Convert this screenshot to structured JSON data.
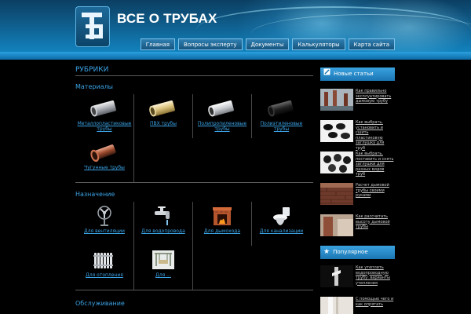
{
  "site": {
    "title": "ВСЕ О ТРУБАХ",
    "logo_icon": "pipe-logo-icon"
  },
  "nav": [
    "Главная",
    "Вопросы эксперту",
    "Документы",
    "Калькуляторы",
    "Карта сайта"
  ],
  "main": {
    "heading": "РУБРИКИ",
    "sections": [
      {
        "title": "Материалы",
        "items": [
          {
            "label": "Металлопластиковые трубы",
            "icon": "silver-pipe-icon"
          },
          {
            "label": "ПВХ трубы",
            "icon": "beige-pipe-icon"
          },
          {
            "label": "Полипропиленовые трубы",
            "icon": "white-pipe-icon"
          },
          {
            "label": "Полиэтиленовые трубы",
            "icon": "black-pipe-icon"
          },
          {
            "label": "Чугунные трубы",
            "icon": "cast-iron-pipe-icon"
          }
        ]
      },
      {
        "title": "Назначение",
        "items": [
          {
            "label": "Для вентиляции",
            "icon": "fan-icon"
          },
          {
            "label": "Для водопровода",
            "icon": "faucet-icon"
          },
          {
            "label": "Для дымохода",
            "icon": "fireplace-icon"
          },
          {
            "label": "Для канализации",
            "icon": "toilet-icon"
          },
          {
            "label": "Для отопления",
            "icon": "radiator-icon"
          },
          {
            "label": "Для ...",
            "icon": "swing-icon"
          }
        ]
      },
      {
        "title": "Обслуживание",
        "items": []
      }
    ]
  },
  "sidebar": {
    "new_articles": {
      "title": "Новые статьи",
      "icon": "pencil-icon",
      "items": [
        "Как правильно эксплуатировать дымовую трубу",
        "Как выбрать, установить и сшить пластиковую заглушку для труб",
        "Как выбрать, поставить и снять заглушки для разных видов труб",
        "Расчет дымовой трубы своими руками",
        "Как рассчитать высоту дымовой трубы"
      ]
    },
    "popular": {
      "title": "Популярное",
      "icon": "star-icon",
      "items": [
        "Как утеплить водопроводную трубу: варианты утепления",
        "С помощью чего и как опрятать"
      ]
    }
  }
}
